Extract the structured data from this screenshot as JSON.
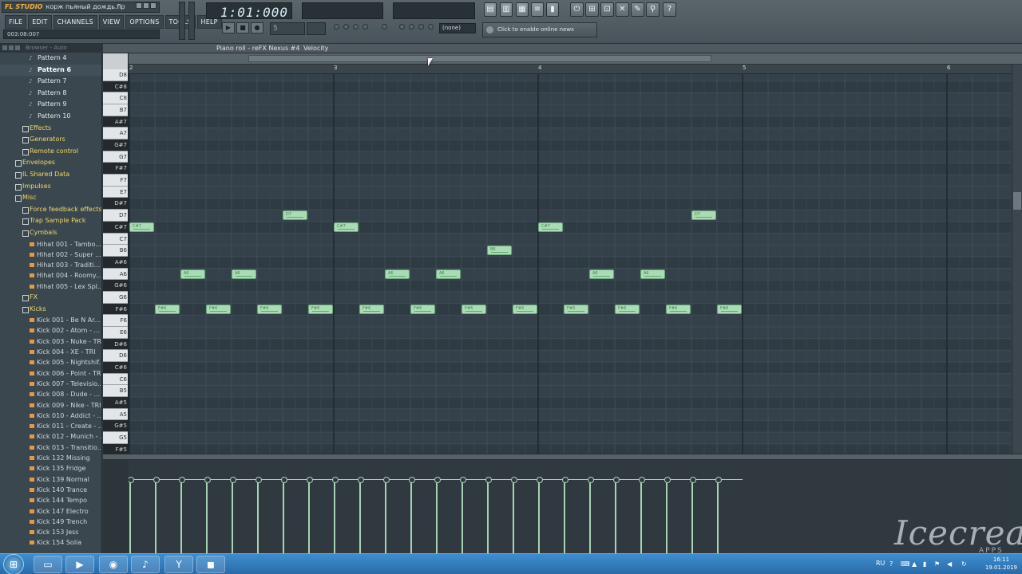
{
  "window": {
    "title_brand": "FL STUDIO",
    "title_file": "корж пьяный дождь.flp",
    "hint": "003:08:007"
  },
  "menu": [
    "FILE",
    "EDIT",
    "CHANNELS",
    "VIEW",
    "OPTIONS",
    "TOOLS",
    "HELP"
  ],
  "transport": {
    "time": "1:01:000",
    "pattern": "5",
    "snap_none": "(none)",
    "news": "Click to enable online news"
  },
  "browser": {
    "header": "Browser - Auto",
    "items": [
      {
        "label": "Pattern 4",
        "kind": "pattern"
      },
      {
        "label": "Pattern 6",
        "kind": "pattern",
        "active": true
      },
      {
        "label": "Pattern 7",
        "kind": "pattern"
      },
      {
        "label": "Pattern 8",
        "kind": "pattern"
      },
      {
        "label": "Pattern 9",
        "kind": "pattern"
      },
      {
        "label": "Pattern 10",
        "kind": "pattern"
      },
      {
        "label": "Effects",
        "kind": "folder"
      },
      {
        "label": "Generators",
        "kind": "folder"
      },
      {
        "label": "Remote control",
        "kind": "folder"
      },
      {
        "label": "Envelopes",
        "kind": "folder-top"
      },
      {
        "label": "IL Shared Data",
        "kind": "folder-top"
      },
      {
        "label": "Impulses",
        "kind": "folder-top"
      },
      {
        "label": "Misc",
        "kind": "folder-top"
      },
      {
        "label": "Force feedback effects",
        "kind": "folder"
      },
      {
        "label": "Trap Sample Pack",
        "kind": "folder"
      },
      {
        "label": "Cymbals",
        "kind": "folder"
      },
      {
        "label": "Hihat 001 - Tambo...",
        "kind": "sample"
      },
      {
        "label": "Hihat 002 - Super ...",
        "kind": "sample"
      },
      {
        "label": "Hihat 003 - Traditi...",
        "kind": "sample"
      },
      {
        "label": "Hihat 004 - Roomy...",
        "kind": "sample"
      },
      {
        "label": "Hihat 005 - Lex Spl...",
        "kind": "sample"
      },
      {
        "label": "FX",
        "kind": "folder"
      },
      {
        "label": "Kicks",
        "kind": "folder"
      },
      {
        "label": "Kick 001 - Be N Ar...",
        "kind": "sample"
      },
      {
        "label": "Kick 002 - Atom - ...",
        "kind": "sample"
      },
      {
        "label": "Kick 003 - Nuke - TRI",
        "kind": "sample"
      },
      {
        "label": "Kick 004 - XE - TRI",
        "kind": "sample"
      },
      {
        "label": "Kick 005 - Nightshif...",
        "kind": "sample"
      },
      {
        "label": "Kick 006 - Point - TRI",
        "kind": "sample"
      },
      {
        "label": "Kick 007 - Televisio...",
        "kind": "sample"
      },
      {
        "label": "Kick 008 - Dude - ...",
        "kind": "sample"
      },
      {
        "label": "Kick 009 - Nike - TRI",
        "kind": "sample"
      },
      {
        "label": "Kick 010 - Addict - ...",
        "kind": "sample"
      },
      {
        "label": "Kick 011 - Create - ...",
        "kind": "sample"
      },
      {
        "label": "Kick 012 - Munich - ...",
        "kind": "sample"
      },
      {
        "label": "Kick 013 - Transitio...",
        "kind": "sample"
      },
      {
        "label": "Kick 132 Missing",
        "kind": "sample"
      },
      {
        "label": "Kick 135 Fridge",
        "kind": "sample"
      },
      {
        "label": "Kick 139 Normal",
        "kind": "sample"
      },
      {
        "label": "Kick 140 Trance",
        "kind": "sample"
      },
      {
        "label": "Kick 144 Tempo",
        "kind": "sample"
      },
      {
        "label": "Kick 147 Electro",
        "kind": "sample"
      },
      {
        "label": "Kick 149 Trench",
        "kind": "sample"
      },
      {
        "label": "Kick 153 Jess",
        "kind": "sample"
      },
      {
        "label": "Kick 154 Solia",
        "kind": "sample"
      }
    ]
  },
  "piano_roll": {
    "title": "Piano roll - reFX Nexus #4",
    "subview": "Velocity",
    "bars": [
      "2",
      "3",
      "4",
      "5",
      "6"
    ],
    "keys": [
      "D8",
      "C#8",
      "C8",
      "B7",
      "A#7",
      "A7",
      "G#7",
      "G7",
      "F#7",
      "F7",
      "E7",
      "D#7",
      "D7",
      "C#7",
      "C7",
      "B6",
      "A#6",
      "A6",
      "G#6",
      "G6",
      "F#6",
      "F6",
      "E6",
      "D#6",
      "D6",
      "C#6",
      "C6",
      "B5",
      "A#5",
      "A5",
      "G#5",
      "G5",
      "F#5"
    ],
    "notes": [
      {
        "pitch": "C#7",
        "start": 0,
        "len": 1
      },
      {
        "pitch": "F#6",
        "start": 1,
        "len": 1
      },
      {
        "pitch": "A6",
        "start": 2,
        "len": 1
      },
      {
        "pitch": "F#6",
        "start": 3,
        "len": 1
      },
      {
        "pitch": "A6",
        "start": 4,
        "len": 1
      },
      {
        "pitch": "F#6",
        "start": 5,
        "len": 1
      },
      {
        "pitch": "D7",
        "start": 6,
        "len": 1
      },
      {
        "pitch": "F#6",
        "start": 7,
        "len": 1
      },
      {
        "pitch": "C#7",
        "start": 8,
        "len": 1
      },
      {
        "pitch": "F#6",
        "start": 9,
        "len": 1
      },
      {
        "pitch": "A6",
        "start": 10,
        "len": 1
      },
      {
        "pitch": "F#6",
        "start": 11,
        "len": 1
      },
      {
        "pitch": "A6",
        "start": 12,
        "len": 1
      },
      {
        "pitch": "F#6",
        "start": 13,
        "len": 1
      },
      {
        "pitch": "B6",
        "start": 14,
        "len": 1
      },
      {
        "pitch": "F#6",
        "start": 15,
        "len": 1
      },
      {
        "pitch": "C#7",
        "start": 16,
        "len": 1
      },
      {
        "pitch": "F#6",
        "start": 17,
        "len": 1
      },
      {
        "pitch": "A6",
        "start": 18,
        "len": 1
      },
      {
        "pitch": "F#6",
        "start": 19,
        "len": 1
      },
      {
        "pitch": "A6",
        "start": 20,
        "len": 1
      },
      {
        "pitch": "F#6",
        "start": 21,
        "len": 1
      },
      {
        "pitch": "D7",
        "start": 22,
        "len": 1
      },
      {
        "pitch": "F#6",
        "start": 23,
        "len": 1
      }
    ]
  },
  "watermark": {
    "text": "Icecream",
    "sub": "APPS"
  },
  "taskbar": {
    "lang": "RU",
    "time": "16:11",
    "date": "19.01.2019"
  },
  "colors": {
    "note": "#a9dcb4",
    "grid": "#34414a",
    "taskbar": "#2a6aa8"
  }
}
